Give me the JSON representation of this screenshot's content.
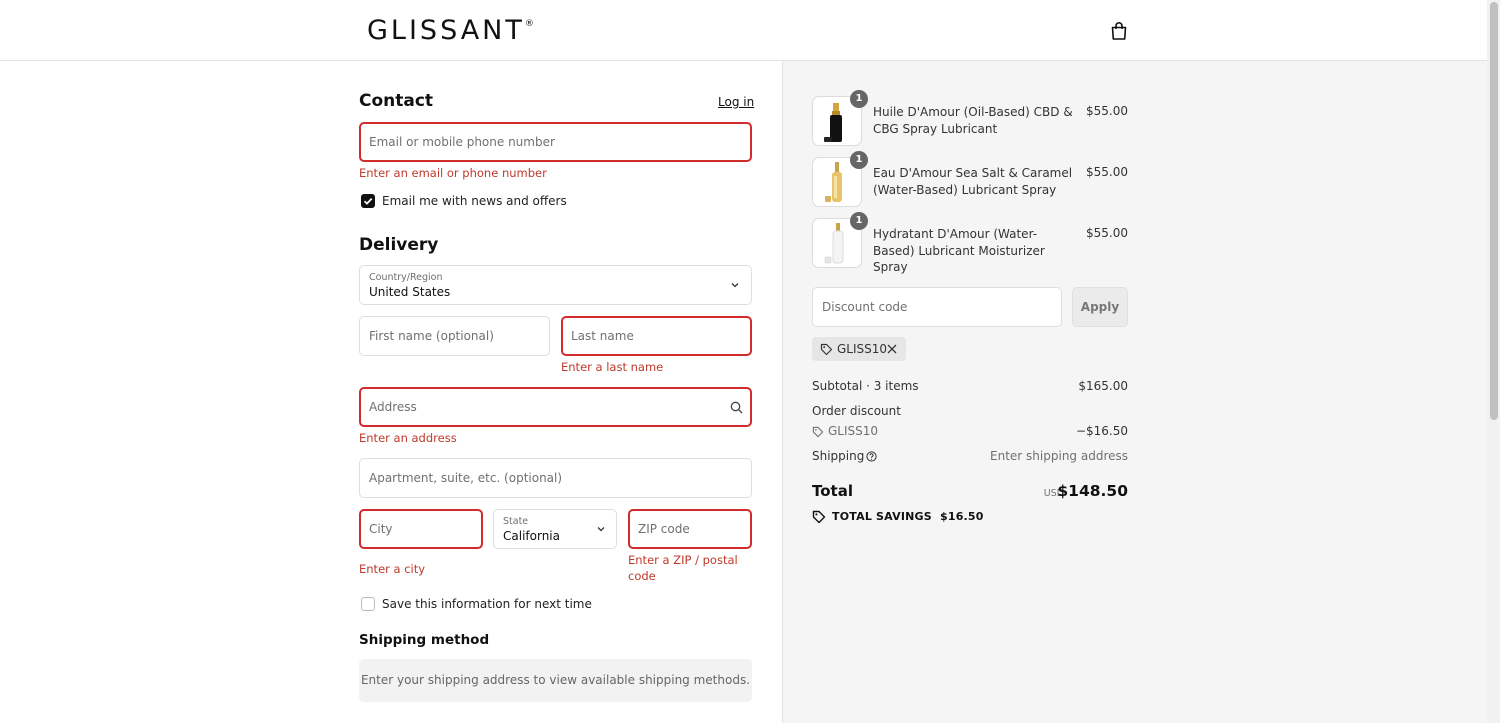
{
  "brand": {
    "logo": "GLISSANT",
    "mark": "®"
  },
  "contact": {
    "title": "Contact",
    "login_link": "Log in",
    "email_placeholder": "Email or mobile phone number",
    "email_error": "Enter an email or phone number",
    "newsletter_label": "Email me with news and offers",
    "newsletter_checked": true
  },
  "delivery": {
    "title": "Delivery",
    "country_label": "Country/Region",
    "country_value": "United States",
    "first_name_placeholder": "First name (optional)",
    "last_name_placeholder": "Last name",
    "last_name_error": "Enter a last name",
    "address_placeholder": "Address",
    "address_error": "Enter an address",
    "apartment_placeholder": "Apartment, suite, etc. (optional)",
    "city_placeholder": "City",
    "city_error": "Enter a city",
    "state_label": "State",
    "state_value": "California",
    "zip_placeholder": "ZIP code",
    "zip_error_line1": "Enter a ZIP / postal",
    "zip_error_line2": "code",
    "save_info_label": "Save this information for next time",
    "save_info_checked": false
  },
  "shipping_method": {
    "title": "Shipping method",
    "message": "Enter your shipping address to view available shipping methods."
  },
  "cart": {
    "items": [
      {
        "quantity": "1",
        "name": "Huile D'Amour (Oil-Based) CBD & CBG Spray Lubricant",
        "price": "$55.00"
      },
      {
        "quantity": "1",
        "name": "Eau D'Amour Sea Salt & Caramel (Water-Based) Lubricant Spray",
        "price": "$55.00"
      },
      {
        "quantity": "1",
        "name": "Hydratant D'Amour (Water-Based) Lubricant Moisturizer Spray",
        "price": "$55.00"
      }
    ],
    "discount_placeholder": "Discount code",
    "apply_label": "Apply",
    "applied_code": "GLISS10"
  },
  "summary": {
    "subtotal_label": "Subtotal · 3 items",
    "subtotal_value": "$165.00",
    "order_discount_label": "Order discount",
    "discount_code": "GLISS10",
    "discount_value": "−$16.50",
    "shipping_label": "Shipping",
    "shipping_value": "Enter shipping address",
    "total_label": "Total",
    "currency": "USD",
    "total_value": "$148.50",
    "savings_label": "TOTAL SAVINGS",
    "savings_value": "$16.50"
  },
  "colors": {
    "error": "#d12b2b",
    "panel_bg": "#f5f5f5",
    "text": "#111111"
  }
}
